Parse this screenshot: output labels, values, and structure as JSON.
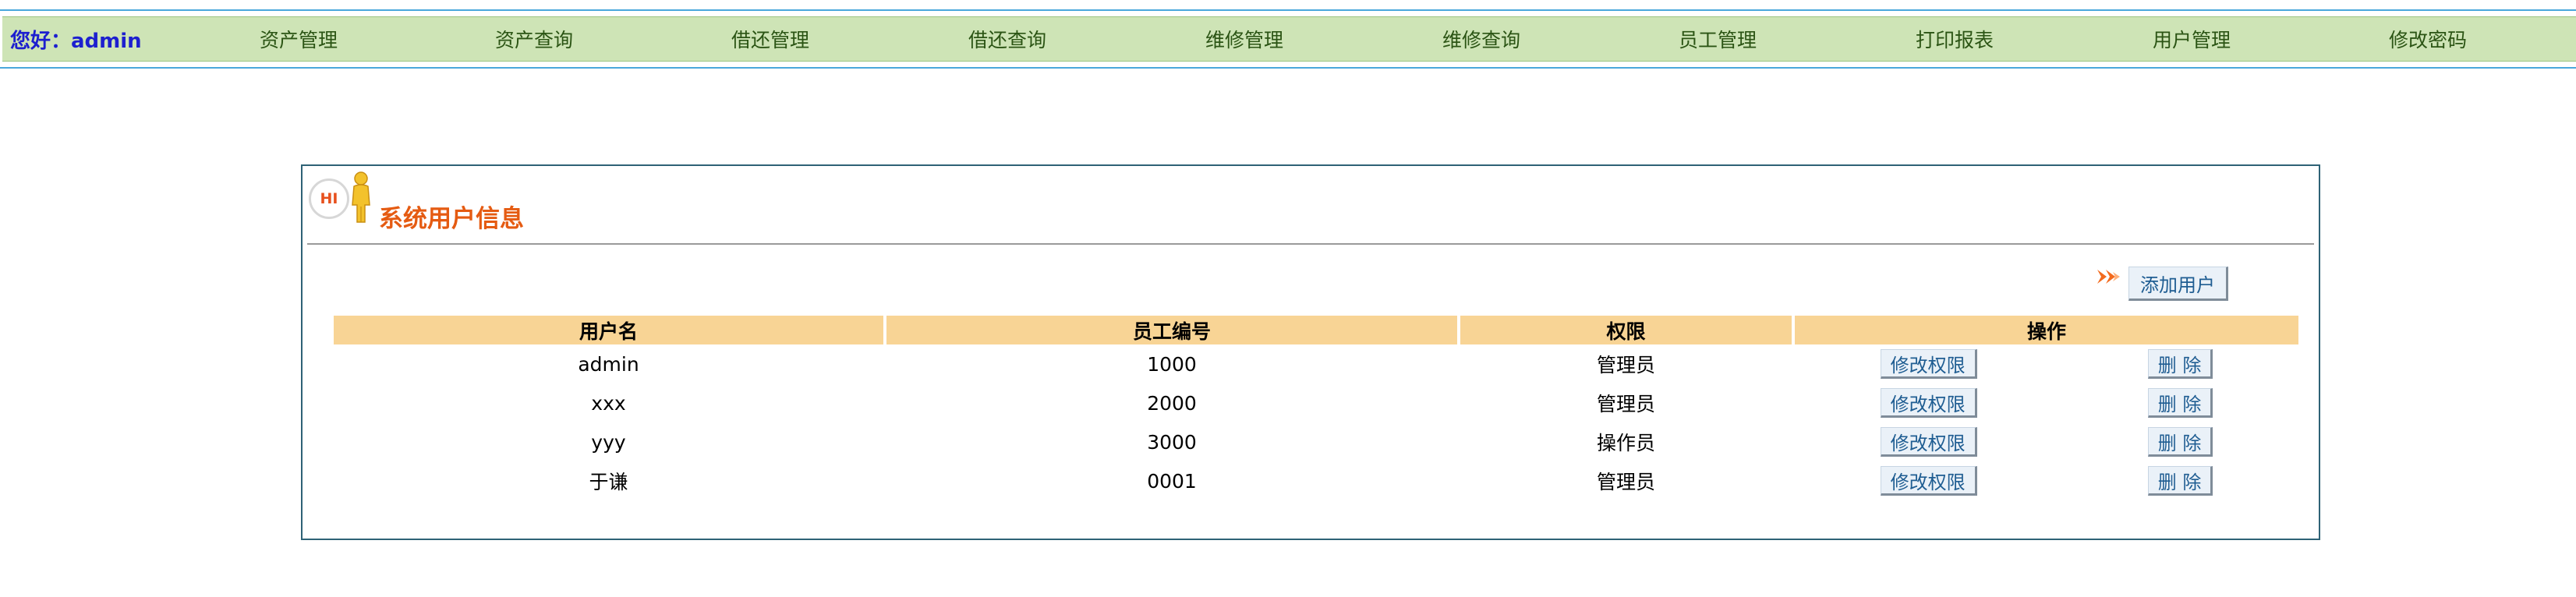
{
  "header": {
    "greeting": "您好：admin",
    "nav": [
      {
        "label": "资产管理",
        "name": "nav-asset-management"
      },
      {
        "label": "资产查询",
        "name": "nav-asset-query"
      },
      {
        "label": "借还管理",
        "name": "nav-borrow-management"
      },
      {
        "label": "借还查询",
        "name": "nav-borrow-query"
      },
      {
        "label": "维修管理",
        "name": "nav-repair-management"
      },
      {
        "label": "维修查询",
        "name": "nav-repair-query"
      },
      {
        "label": "员工管理",
        "name": "nav-employee-management"
      },
      {
        "label": "打印报表",
        "name": "nav-print-report"
      },
      {
        "label": "用户管理",
        "name": "nav-user-management"
      },
      {
        "label": "修改密码",
        "name": "nav-change-password"
      }
    ]
  },
  "panel": {
    "hi_badge": "HI",
    "title": "系统用户信息",
    "add_button": "添加用户"
  },
  "table": {
    "headers": [
      "用户名",
      "员工编号",
      "权限",
      "操作"
    ],
    "edit_label": "修改权限",
    "delete_label": "删 除",
    "rows": [
      {
        "username": "admin",
        "employee_id": "1000",
        "role": "管理员"
      },
      {
        "username": "xxx",
        "employee_id": "2000",
        "role": "管理员"
      },
      {
        "username": "yyy",
        "employee_id": "3000",
        "role": "操作员"
      },
      {
        "username": "于谦",
        "employee_id": "0001",
        "role": "管理员"
      }
    ]
  },
  "colors": {
    "nav_bg": "#cee4b6",
    "nav_border": "#4aa7dc",
    "greeting": "#1d1fcf",
    "title": "#e55b12",
    "table_header_bg": "#f8d495",
    "panel_border": "#2e6276"
  }
}
